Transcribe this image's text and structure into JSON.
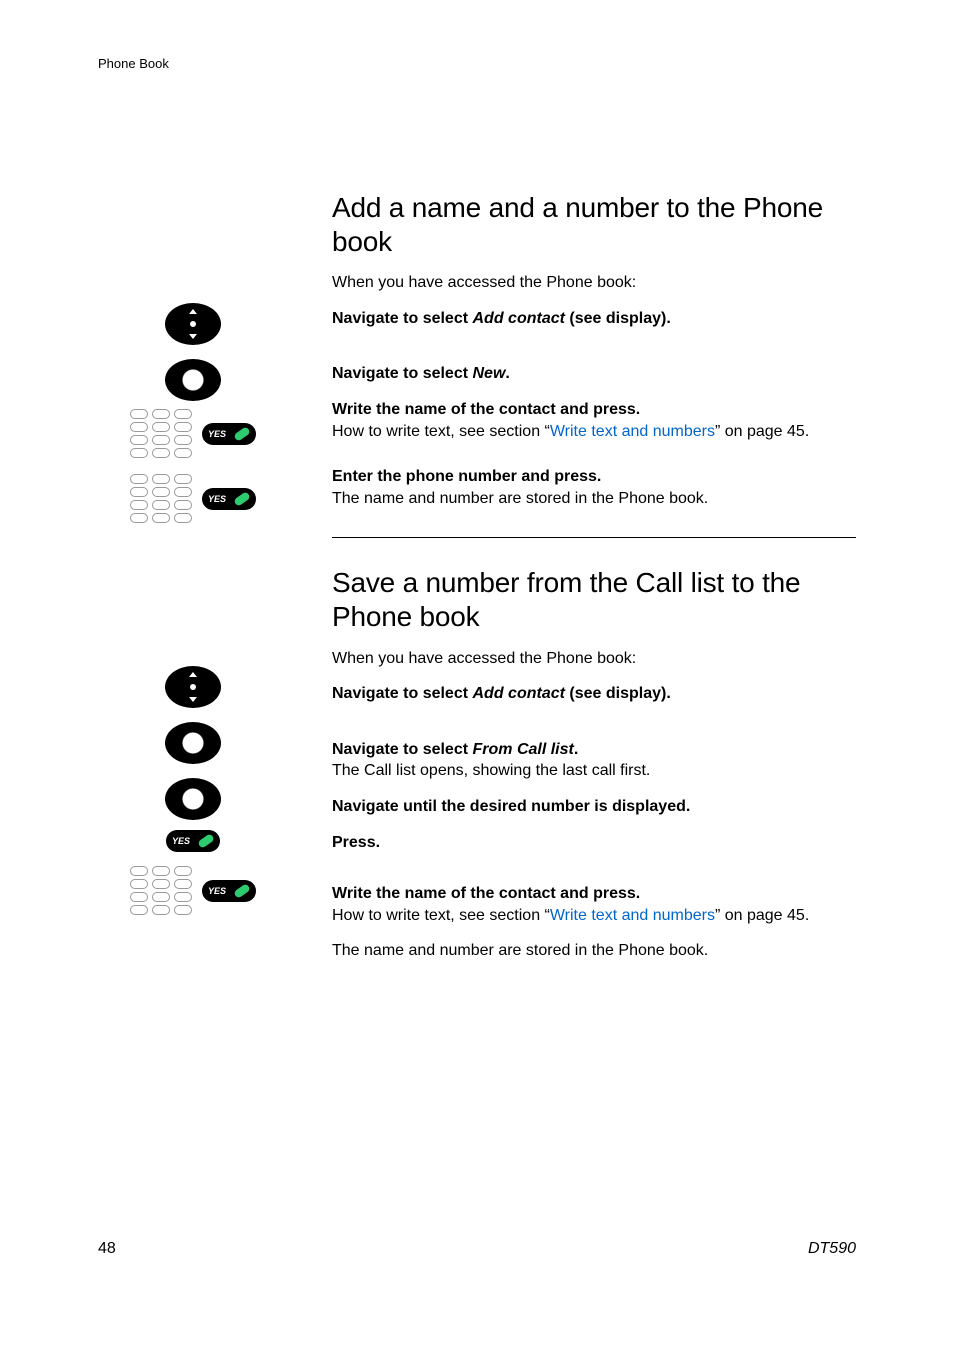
{
  "runningHead": "Phone Book",
  "section1": {
    "heading": "Add a name and a number to the Phone book",
    "intro": "When you have accessed the Phone book:",
    "step1_lead_a": "Navigate to select ",
    "step1_lead_ital": "Add contact",
    "step1_lead_b": " (see display).",
    "step2_lead_a": "Navigate to select ",
    "step2_lead_ital": "New",
    "step2_lead_b": ".",
    "step3_lead": "Write the name of the contact and press.",
    "step3_body_a": "How to write text, see section “",
    "step3_link": "Write text and numbers",
    "step3_body_b": "” on page 45.",
    "step4_lead": "Enter the phone number and press.",
    "step4_body": "The name and number are stored in the Phone book."
  },
  "section2": {
    "heading": "Save a number from the Call list to the Phone book",
    "intro": "When you have accessed the Phone book:",
    "step1_lead_a": "Navigate to select ",
    "step1_lead_ital": "Add contact",
    "step1_lead_b": " (see display).",
    "step2_lead_a": "Navigate to select ",
    "step2_lead_ital": "From Call list",
    "step2_lead_b": ".",
    "step2_body": "The Call list opens, showing the last call first.",
    "step3_lead": "Navigate until the desired number is displayed.",
    "step4_lead": "Press.",
    "step5_lead": "Write the name of the contact and press.",
    "step5_body_a": "How to write text, see section “",
    "step5_link": "Write text and numbers",
    "step5_body_b": "” on page 45.",
    "closing": "The name and number are stored in the Phone book."
  },
  "yesLabel": "YES",
  "footer": {
    "pageNumber": "48",
    "model": "DT590"
  }
}
